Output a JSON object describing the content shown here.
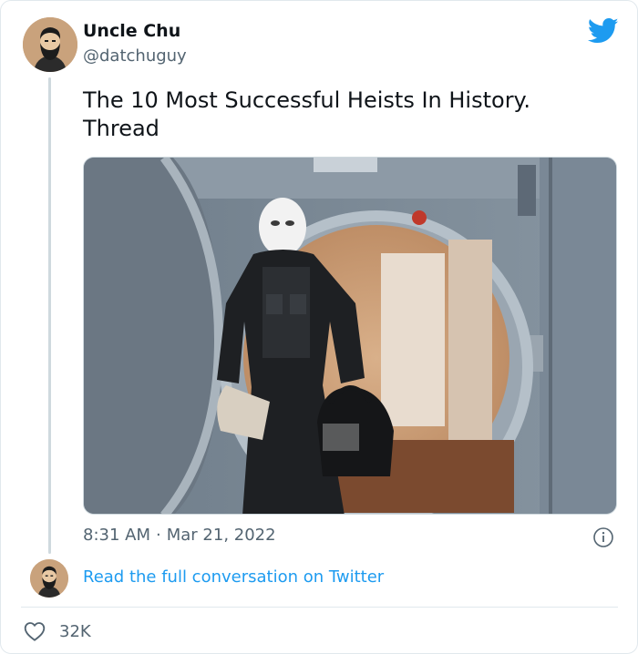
{
  "author": {
    "display_name": "Uncle Chu",
    "handle": "@datchuguy"
  },
  "tweet": {
    "text_lines": [
      "The 10 Most Successful Heists In History.",
      "Thread"
    ],
    "image_description": "",
    "time": "8:31 AM",
    "separator": "·",
    "date": "Mar 21, 2022"
  },
  "footer": {
    "read_link": "Read the full conversation on Twitter",
    "like_count": "32K"
  },
  "colors": {
    "twitter_blue": "#1d9bf0",
    "muted_text": "#536471",
    "avatar_bg": "#c9a27c"
  },
  "icons": {
    "logo": "twitter-bird-icon",
    "info": "info-icon",
    "like": "heart-icon"
  }
}
